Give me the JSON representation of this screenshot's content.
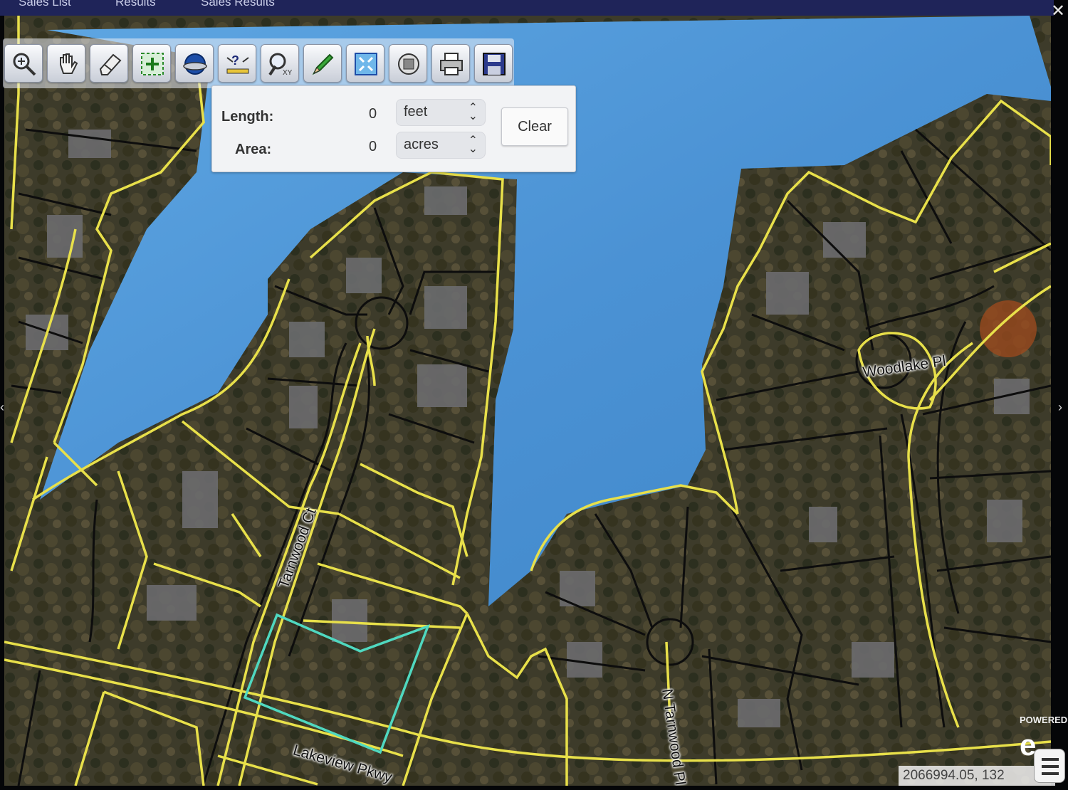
{
  "nav": {
    "tabs": [
      "Sales List",
      "Results",
      "Sales Results"
    ]
  },
  "toolbar": {
    "tools": [
      {
        "icon": "zoom-in-icon"
      },
      {
        "icon": "pan-hand-icon"
      },
      {
        "icon": "eraser-icon"
      },
      {
        "icon": "select-area-icon"
      },
      {
        "icon": "globe-layers-icon"
      },
      {
        "icon": "identify-query-icon"
      },
      {
        "icon": "zoom-xy-icon"
      },
      {
        "icon": "pencil-draw-icon"
      },
      {
        "icon": "full-extent-icon"
      },
      {
        "icon": "parcel-buffer-icon"
      },
      {
        "icon": "print-icon"
      },
      {
        "icon": "save-icon"
      }
    ]
  },
  "measure": {
    "length_label": "Length:",
    "length_value": "0",
    "length_unit": "feet",
    "area_label": "Area:",
    "area_value": "0",
    "area_unit": "acres",
    "clear_label": "Clear"
  },
  "map": {
    "streets": {
      "woodlake": "Woodlake Pl",
      "tarnwood_ct": "Tarnwood Ct",
      "lakeview": "Lakeview Pkwy",
      "n_tarnwood": "N Tarnwood Pl"
    },
    "colors": {
      "parcel_line": "#e8e04a",
      "lot_line": "#111111",
      "selected_parcel": "#4fd8c0",
      "water": "#4a8fd0"
    },
    "coordinates": "2066994.05, 132",
    "powered_by": "POWERED"
  }
}
